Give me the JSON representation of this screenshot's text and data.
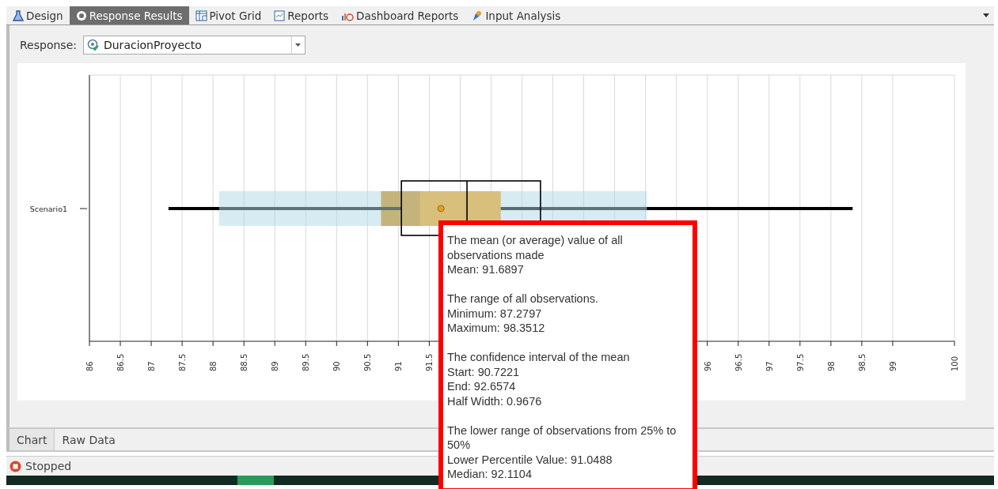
{
  "tabs": [
    {
      "label": "Design",
      "kind": "flask",
      "selected": false
    },
    {
      "label": "Response Results",
      "kind": "gauge",
      "selected": true
    },
    {
      "label": "Pivot Grid",
      "kind": "grid",
      "selected": false
    },
    {
      "label": "Reports",
      "kind": "report",
      "selected": false
    },
    {
      "label": "Dashboard Reports",
      "kind": "dashboard",
      "selected": false
    },
    {
      "label": "Input Analysis",
      "kind": "analysis",
      "selected": false
    }
  ],
  "response": {
    "label": "Response:",
    "value": "DuracionProyecto"
  },
  "chart": {
    "category": "Scenario1",
    "axis_labels": [
      "86",
      "86.5",
      "87",
      "87.5",
      "88",
      "88.5",
      "89",
      "89.5",
      "90",
      "90.5",
      "91",
      "91.5",
      "96",
      "96.5",
      "97",
      "97.5",
      "98",
      "98.5",
      "99",
      "100"
    ]
  },
  "tooltip": {
    "blocks": [
      {
        "lines": [
          "The mean (or average) value of all observations made",
          "Mean: 91.6897"
        ]
      },
      {
        "lines": [
          "The range of all observations.",
          "Minimum: 87.2797",
          "Maximum: 98.3512"
        ]
      },
      {
        "lines": [
          "The confidence interval of the mean",
          "Start: 90.7221",
          "End: 92.6574",
          "Half Width: 0.9676"
        ]
      },
      {
        "lines": [
          "The lower range of observations from 25% to 50%",
          "Lower Percentile Value: 91.0488",
          "Median: 92.1104"
        ]
      }
    ]
  },
  "bottom_tabs": [
    {
      "label": "Chart",
      "selected": true
    },
    {
      "label": "Raw Data",
      "selected": false
    }
  ],
  "status": {
    "text": "Stopped"
  }
}
